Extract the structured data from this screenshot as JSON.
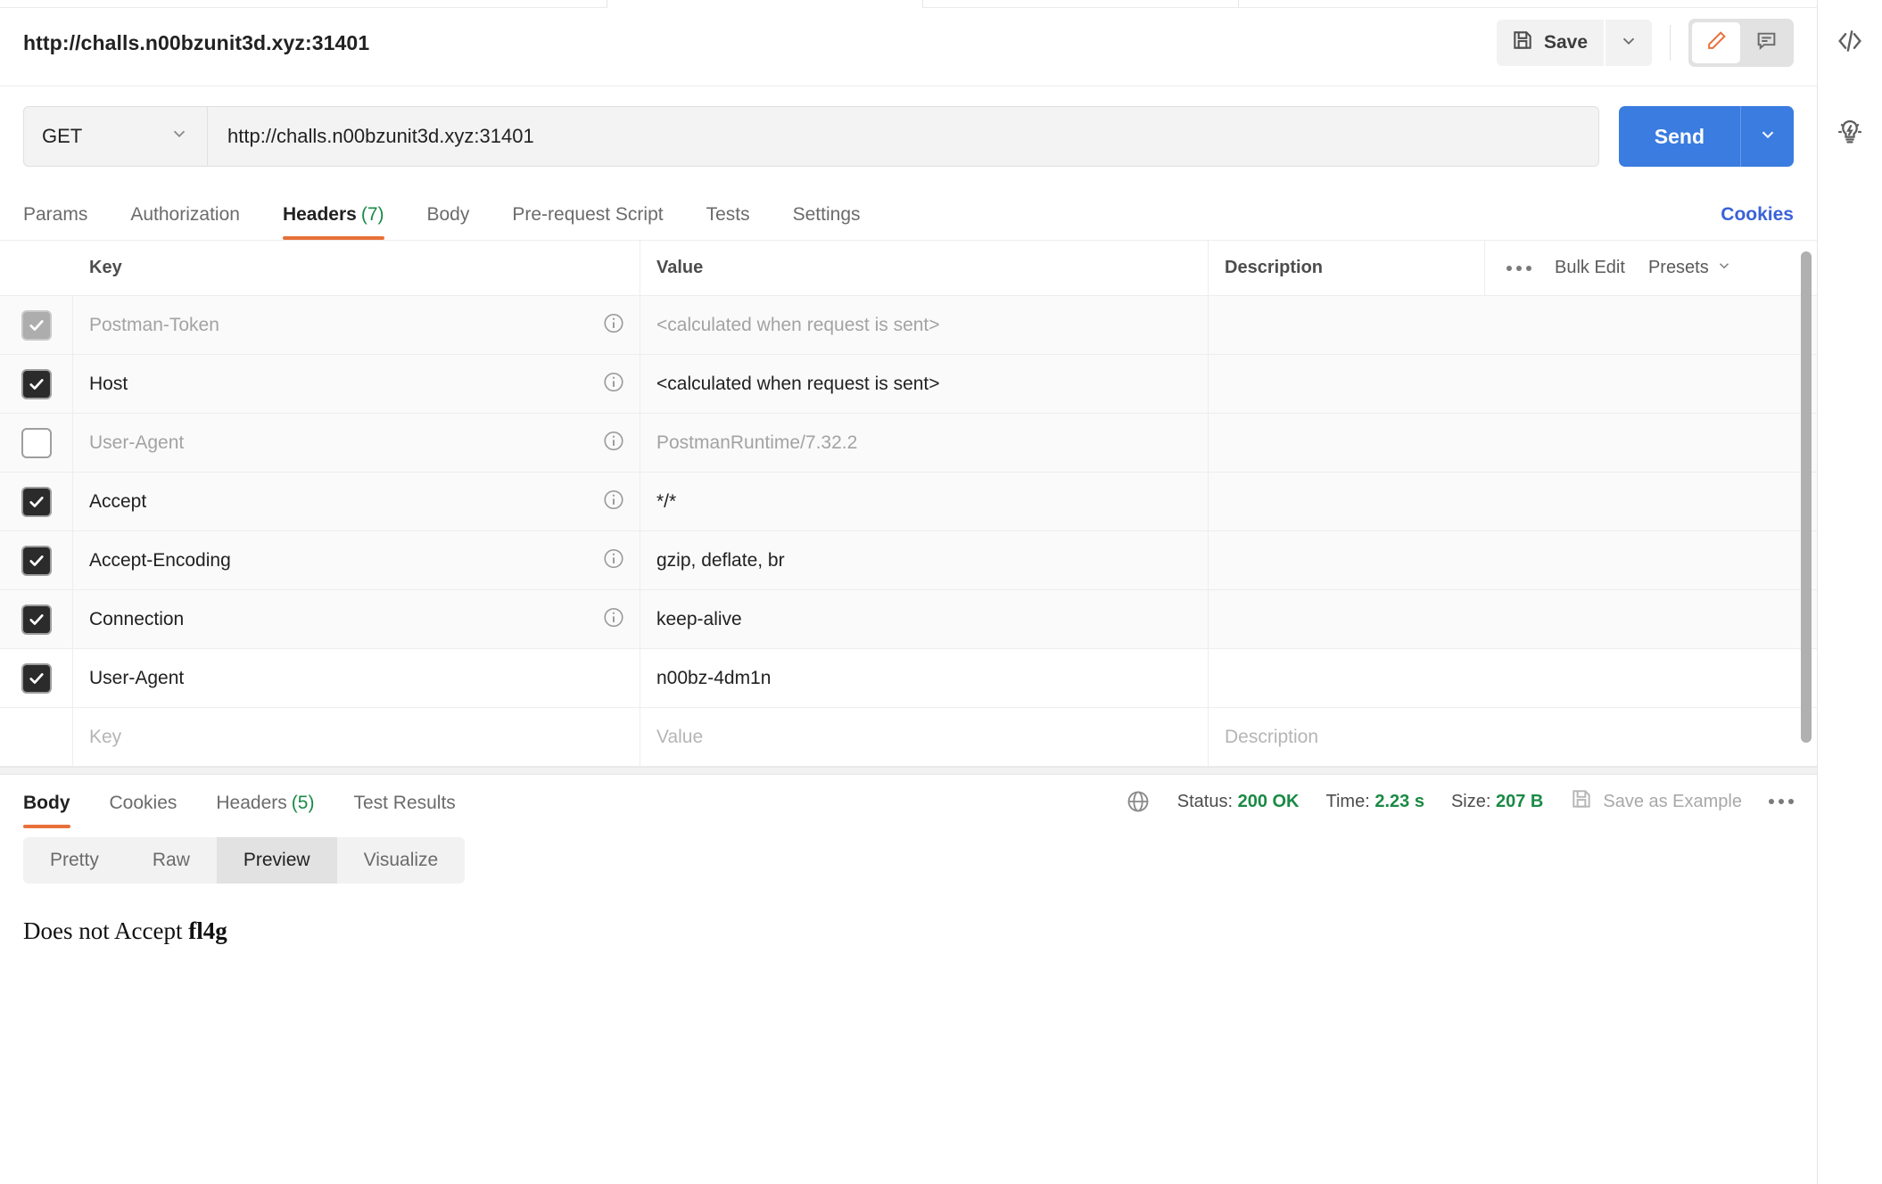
{
  "request": {
    "title": "http://challs.n00bzunit3d.xyz:31401",
    "method": "GET",
    "url": "http://challs.n00bzunit3d.xyz:31401",
    "send_label": "Send"
  },
  "toolbar": {
    "save_label": "Save",
    "save_icon": "floppy-disk-icon",
    "save_caret_icon": "chevron-down-icon",
    "edit_icon": "pencil-icon",
    "comment_icon": "comment-icon",
    "accent_orange": "#e8703a",
    "accent_blue": "#3a7ce0"
  },
  "right_rail": {
    "items": [
      {
        "name": "code-icon",
        "glyph": "</>"
      },
      {
        "name": "lightbulb-icon",
        "glyph": "bulb"
      }
    ]
  },
  "request_tabs": {
    "items": [
      {
        "label": "Params",
        "count": "",
        "active": false
      },
      {
        "label": "Authorization",
        "count": "",
        "active": false
      },
      {
        "label": "Headers",
        "count": "(7)",
        "active": true
      },
      {
        "label": "Body",
        "count": "",
        "active": false
      },
      {
        "label": "Pre-request Script",
        "count": "",
        "active": false
      },
      {
        "label": "Tests",
        "count": "",
        "active": false
      },
      {
        "label": "Settings",
        "count": "",
        "active": false
      }
    ],
    "cookies_label": "Cookies"
  },
  "headers_table": {
    "columns": {
      "key": "Key",
      "value": "Value",
      "description": "Description"
    },
    "actions": {
      "bulk_edit": "Bulk Edit",
      "presets": "Presets",
      "more_icon": "more-horizontal-icon",
      "presets_caret": "chevron-down-icon"
    },
    "rows": [
      {
        "checked": true,
        "disabled": true,
        "info": true,
        "key": "Postman-Token",
        "value": "<calculated when request is sent>",
        "description": "",
        "muted": true,
        "shaded": true
      },
      {
        "checked": true,
        "disabled": false,
        "info": true,
        "key": "Host",
        "value": "<calculated when request is sent>",
        "description": "",
        "muted": false,
        "shaded": true
      },
      {
        "checked": false,
        "disabled": false,
        "info": true,
        "key": "User-Agent",
        "value": "PostmanRuntime/7.32.2",
        "description": "",
        "muted": true,
        "shaded": true
      },
      {
        "checked": true,
        "disabled": false,
        "info": true,
        "key": "Accept",
        "value": "*/*",
        "description": "",
        "muted": false,
        "shaded": true
      },
      {
        "checked": true,
        "disabled": false,
        "info": true,
        "key": "Accept-Encoding",
        "value": "gzip, deflate, br",
        "description": "",
        "muted": false,
        "shaded": true
      },
      {
        "checked": true,
        "disabled": false,
        "info": true,
        "key": "Connection",
        "value": "keep-alive",
        "description": "",
        "muted": false,
        "shaded": true
      },
      {
        "checked": true,
        "disabled": false,
        "info": false,
        "key": "User-Agent",
        "value": "n00bz-4dm1n",
        "description": "",
        "muted": false,
        "shaded": false
      }
    ],
    "empty_row": {
      "key_placeholder": "Key",
      "value_placeholder": "Value",
      "description_placeholder": "Description"
    }
  },
  "response": {
    "tabs": [
      {
        "label": "Body",
        "count": "",
        "active": true
      },
      {
        "label": "Cookies",
        "count": "",
        "active": false
      },
      {
        "label": "Headers",
        "count": "(5)",
        "active": false
      },
      {
        "label": "Test Results",
        "count": "",
        "active": false
      }
    ],
    "globe_icon": "globe-icon",
    "status_label": "Status:",
    "status_value": "200 OK",
    "time_label": "Time:",
    "time_value": "2.23 s",
    "size_label": "Size:",
    "size_value": "207 B",
    "save_example_label": "Save as Example",
    "save_example_icon": "floppy-disk-icon",
    "more_icon": "more-horizontal-icon",
    "view_modes": [
      {
        "label": "Pretty",
        "active": false
      },
      {
        "label": "Raw",
        "active": false
      },
      {
        "label": "Preview",
        "active": true
      },
      {
        "label": "Visualize",
        "active": false
      }
    ],
    "body_prefix": "Does not Accept ",
    "body_bold": "fl4g"
  }
}
